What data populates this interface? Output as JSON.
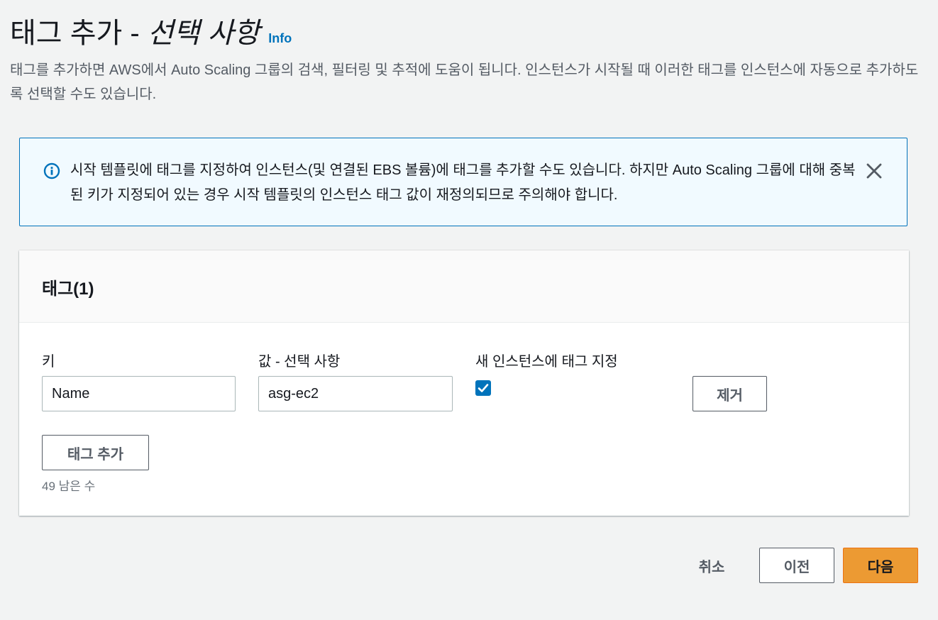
{
  "header": {
    "title_main": "태그 추가 - ",
    "title_optional": "선택 사항",
    "info_link": "Info",
    "description": "태그를 추가하면 AWS에서 Auto Scaling 그룹의 검색, 필터링 및 추적에 도움이 됩니다. 인스턴스가 시작될 때 이러한 태그를 인스턴스에 자동으로 추가하도록 선택할 수도 있습니다."
  },
  "alert": {
    "text": "시작 템플릿에 태그를 지정하여 인스턴스(및 연결된 EBS 볼륨)에 태그를 추가할 수도 있습니다. 하지만 Auto Scaling 그룹에 대해 중복된 키가 지정되어 있는 경우 시작 템플릿의 인스턴스 태그 값이 재정의되므로 주의해야 합니다.",
    "icon": "info-circle-icon",
    "close_icon": "close-icon",
    "accent_color": "#0073bb"
  },
  "tags_card": {
    "title": "태그(1)",
    "key_label": "키",
    "value_label": "값 - 선택 사항",
    "propagate_label": "새 인스턴스에 태그 지정",
    "rows": [
      {
        "key": "Name",
        "value": "asg-ec2",
        "propagate_checked": true,
        "remove_label": "제거"
      }
    ],
    "add_tag_label": "태그 추가",
    "remaining_text": "49 남은 수"
  },
  "footer": {
    "cancel_label": "취소",
    "previous_label": "이전",
    "next_label": "다음",
    "primary_color": "#ec9a33"
  }
}
